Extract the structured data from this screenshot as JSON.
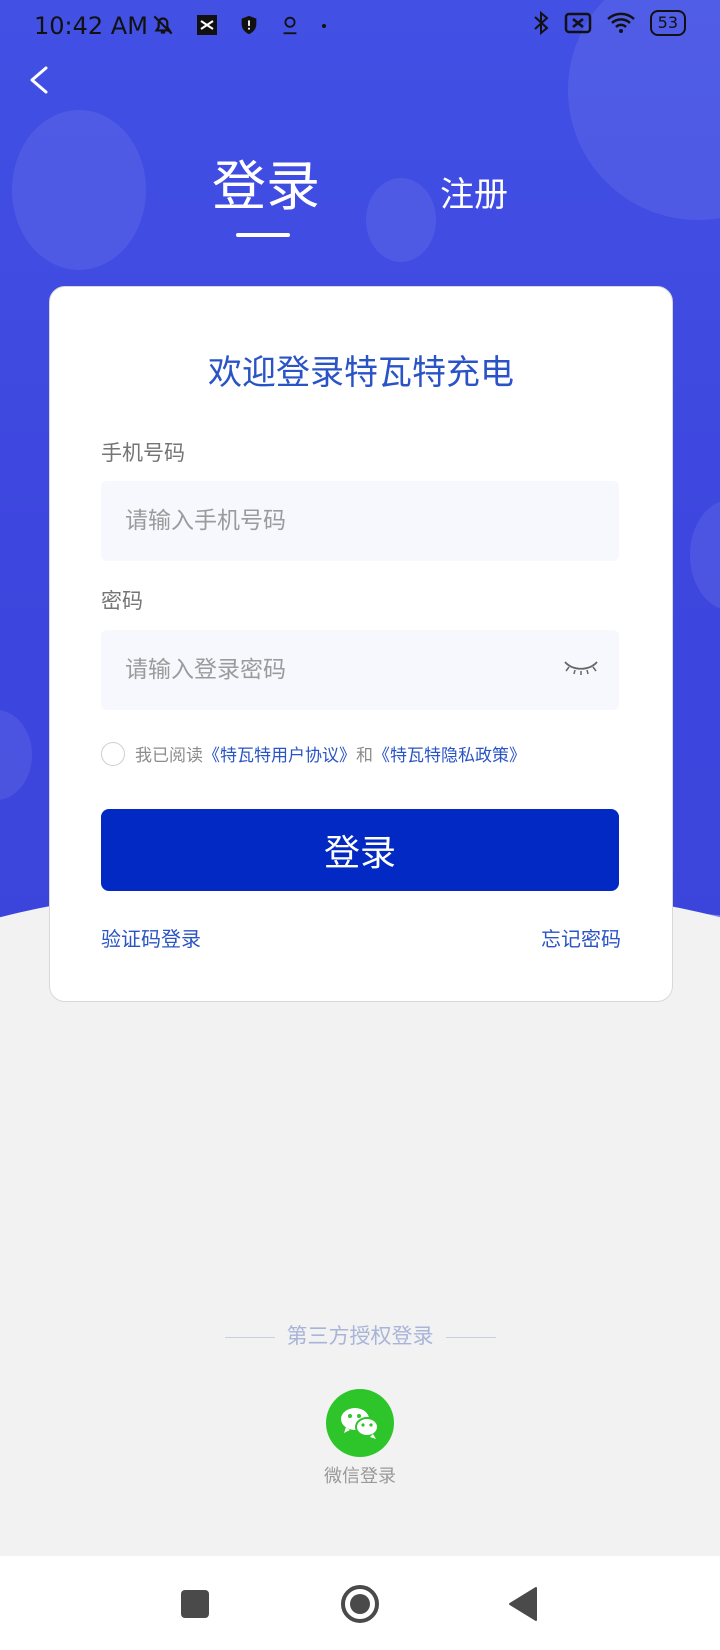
{
  "status_bar": {
    "time": "10:42 AM",
    "battery": "53"
  },
  "tabs": {
    "login": "登录",
    "register": "注册"
  },
  "card": {
    "welcome": "欢迎登录特瓦特充电",
    "phone_label": "手机号码",
    "phone_placeholder": "请输入手机号码",
    "password_label": "密码",
    "password_placeholder": "请输入登录密码",
    "agree_prefix": "我已阅读",
    "agreement_link": "《特瓦特用户协议》",
    "agree_and": "和",
    "privacy_link": "《特瓦特隐私政策》",
    "login_button": "登录",
    "sms_login": "验证码登录",
    "forgot_password": "忘记密码"
  },
  "third_party": {
    "title": "第三方授权登录",
    "wechat_label": "微信登录"
  },
  "colors": {
    "brand_blue": "#3d47df",
    "button_blue": "#0229c3",
    "link_blue": "#2a54c6",
    "wechat_green": "#2ec52b"
  }
}
